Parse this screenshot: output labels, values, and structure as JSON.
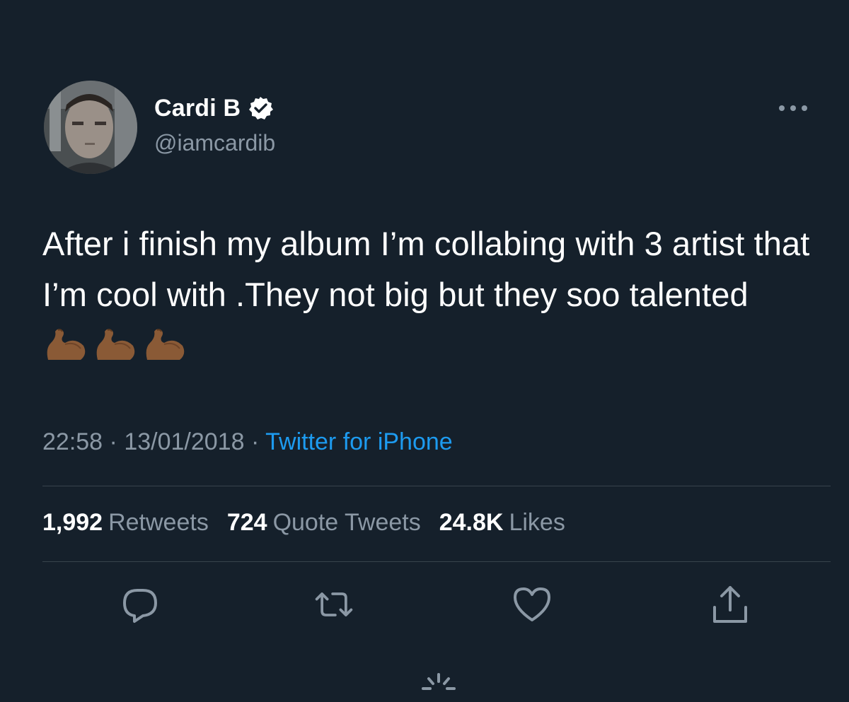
{
  "author": {
    "display_name": "Cardi B",
    "handle": "@iamcardib",
    "verified": true
  },
  "tweet": {
    "text": "After i finish my album I’m collabing with 3 artist that I’m cool with .They not big but they soo talented",
    "emoji": [
      "flexed-biceps",
      "flexed-biceps",
      "flexed-biceps"
    ]
  },
  "meta": {
    "time": "22:58",
    "date": "13/01/2018",
    "separator": "·",
    "source": "Twitter for iPhone"
  },
  "stats": {
    "retweets_count": "1,992",
    "retweets_label": "Retweets",
    "quotes_count": "724",
    "quotes_label": "Quote Tweets",
    "likes_count": "24.8K",
    "likes_label": "Likes"
  },
  "icons": {
    "more": "more-horizontal-icon",
    "reply": "reply-icon",
    "retweet": "retweet-icon",
    "like": "heart-icon",
    "share": "share-icon",
    "verified": "verified-badge-icon",
    "loading": "loading-spinner-icon"
  },
  "colors": {
    "background": "#15202b",
    "primary_text": "#ffffff",
    "secondary_text": "#8b98a5",
    "accent": "#1d9bf0",
    "divider": "#38444d"
  }
}
